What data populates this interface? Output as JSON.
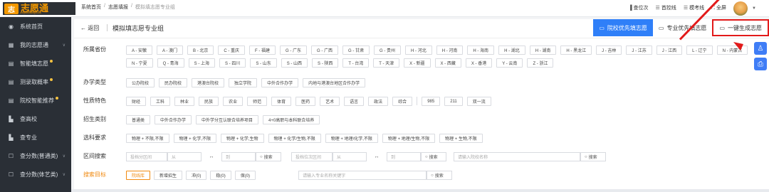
{
  "logo": {
    "mark": "志",
    "text": "志愿通",
    "subtext": "zhiyuantong.com"
  },
  "breadcrumb": {
    "items": [
      "系统首页",
      "志愿填报"
    ],
    "current": "模拟填志愿专业组"
  },
  "toolbar": {
    "items": [
      {
        "icon": "bar-chart-icon",
        "glyph": "▐",
        "label": "查位次"
      },
      {
        "icon": "list-icon",
        "glyph": "☰",
        "label": "首控线"
      },
      {
        "icon": "list-icon",
        "glyph": "☰",
        "label": "模考线"
      },
      {
        "icon": "fullscreen-icon",
        "glyph": "⛶",
        "label": "全屏"
      }
    ]
  },
  "sidebar": {
    "items": [
      {
        "icon": "dashboard-icon",
        "glyph": "◉",
        "label": "系统首页",
        "chevron": false,
        "dot": false
      },
      {
        "icon": "grid-icon",
        "glyph": "▦",
        "label": "我的志愿通",
        "chevron": true,
        "dot": false
      },
      {
        "icon": "doc-icon",
        "glyph": "▤",
        "label": "智能填志愿",
        "chevron": false,
        "dot": true
      },
      {
        "icon": "doc-icon",
        "glyph": "▤",
        "label": "测录取概率",
        "chevron": false,
        "dot": true
      },
      {
        "icon": "doc-icon",
        "glyph": "▤",
        "label": "院校智能推荐",
        "chevron": false,
        "dot": true
      },
      {
        "icon": "school-icon",
        "glyph": "▙",
        "label": "查高校",
        "chevron": false,
        "dot": false
      },
      {
        "icon": "bar-icon",
        "glyph": "▙",
        "label": "查专业",
        "chevron": false,
        "dot": false
      },
      {
        "icon": "chat-icon",
        "glyph": "☐",
        "label": "查分数(普通类)",
        "chevron": true,
        "dot": false
      },
      {
        "icon": "chat-icon",
        "glyph": "☐",
        "label": "查分数(体艺类)",
        "chevron": true,
        "dot": false
      }
    ]
  },
  "page": {
    "back": "← 返回",
    "title": "模拟填志愿专业组"
  },
  "tabs": [
    {
      "icon": "monitor-icon",
      "glyph": "▭",
      "label": "院校优先填志愿",
      "active": true
    },
    {
      "icon": "monitor-icon",
      "glyph": "▭",
      "label": "专业优先填志愿",
      "active": false
    },
    {
      "icon": "monitor-icon",
      "glyph": "▭",
      "label": "一键生成志愿",
      "active": false
    }
  ],
  "filters": {
    "province": {
      "label": "所属省份",
      "options": [
        "A - 安徽",
        "A - 澳门",
        "B - 北京",
        "C - 重庆",
        "F - 福建",
        "G - 广东",
        "G - 广西",
        "G - 甘肃",
        "G - 贵州",
        "H - 河北",
        "H - 河南",
        "H - 海南",
        "H - 湖北",
        "H - 湖南",
        "H - 黑龙江",
        "J - 吉林",
        "J - 江苏",
        "J - 江西",
        "L - 辽宁",
        "N - 内蒙古",
        "N - 宁夏",
        "Q - 青海",
        "S - 上海",
        "S - 四川",
        "S - 山东",
        "S - 山西",
        "S - 陕西",
        "T - 台湾",
        "T - 天津",
        "X - 新疆",
        "X - 西藏",
        "X - 香港",
        "Y - 云南",
        "Z - 浙江"
      ]
    },
    "school_type": {
      "label": "办学类型",
      "options": [
        "公办院校",
        "民办院校",
        "港澳台院校",
        "独立学院",
        "中外合作办学",
        "内地与港澳台地区合作办学"
      ]
    },
    "feature": {
      "label": "性质特色",
      "options_a": [
        "财经",
        "工科",
        "林业",
        "民族",
        "农业",
        "师范",
        "体育",
        "医药",
        "艺术",
        "语言",
        "政法",
        "综合"
      ],
      "options_b": [
        "985",
        "211",
        "双一流"
      ]
    },
    "enroll": {
      "label": "招生类别",
      "options": [
        "普通类",
        "中外合作办学",
        "中外学分互认联合培养项目",
        "4+0高职与本科联合培养"
      ]
    },
    "subjects": {
      "label": "选科要求",
      "options": [
        "物理 + 不限,不限",
        "物理 + 化学,不限",
        "物理 + 化学,生物",
        "物理 + 化学/生物,不限",
        "物理 + 地理/化学,不限",
        "物理 + 地理/生物,不限",
        "物理 + 生物,不限"
      ]
    },
    "range": {
      "label": "区间搜索",
      "score_ph": "投档分区间",
      "from": "从",
      "arrow": "↔",
      "to": "到",
      "search": "搜索",
      "rank_ph": "投档位次区间",
      "school_ph": "请输入院校名称"
    },
    "target": {
      "label": "搜索目标",
      "options": [
        "院线库",
        "新增招生",
        "冲(0)",
        "稳(0)",
        "保(0)"
      ],
      "major_ph": "请输入专业名称关键字",
      "search": "搜索"
    }
  },
  "right_icons": [
    {
      "icon": "user-icon",
      "glyph": "♙"
    },
    {
      "icon": "file-icon",
      "glyph": "⎙"
    }
  ],
  "colors": {
    "accent": "#2f7ff8",
    "highlight": "#e21a1a",
    "orange": "#f18a10",
    "sidebar": "#2a2f36"
  }
}
